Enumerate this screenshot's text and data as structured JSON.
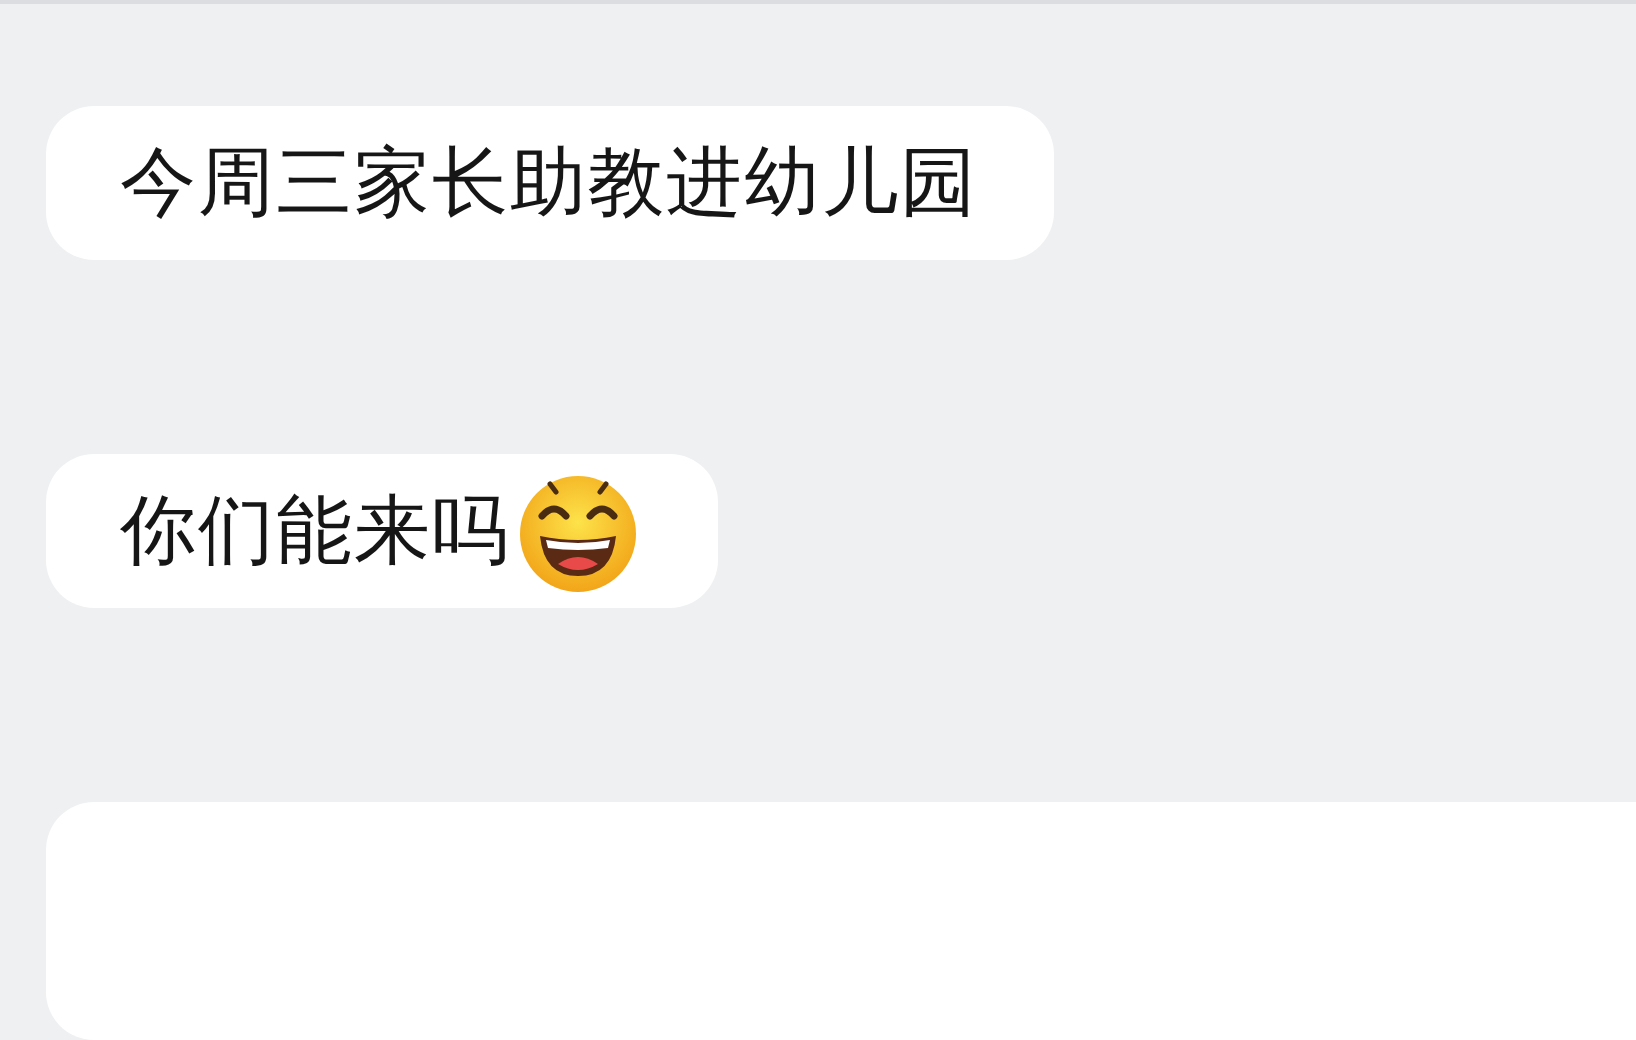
{
  "messages": [
    {
      "kind": "text",
      "text": "今周三家长助教进幼儿园",
      "emoji": false
    },
    {
      "kind": "text",
      "text": "你们能来吗",
      "emoji": true
    },
    {
      "kind": "partial"
    }
  ]
}
